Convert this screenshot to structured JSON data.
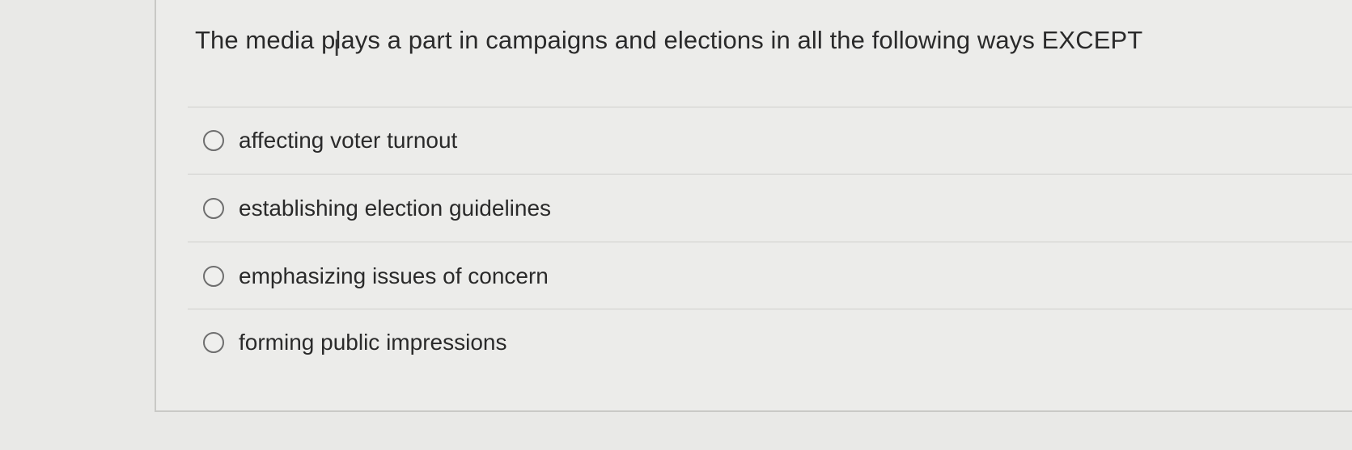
{
  "question": {
    "text": "The media plays a part in campaigns and elections in all the following ways EXCEPT"
  },
  "options": [
    {
      "label": "affecting voter turnout",
      "selected": false
    },
    {
      "label": "establishing election guidelines",
      "selected": false
    },
    {
      "label": "emphasizing issues of concern",
      "selected": false
    },
    {
      "label": "forming public impressions",
      "selected": false
    }
  ]
}
